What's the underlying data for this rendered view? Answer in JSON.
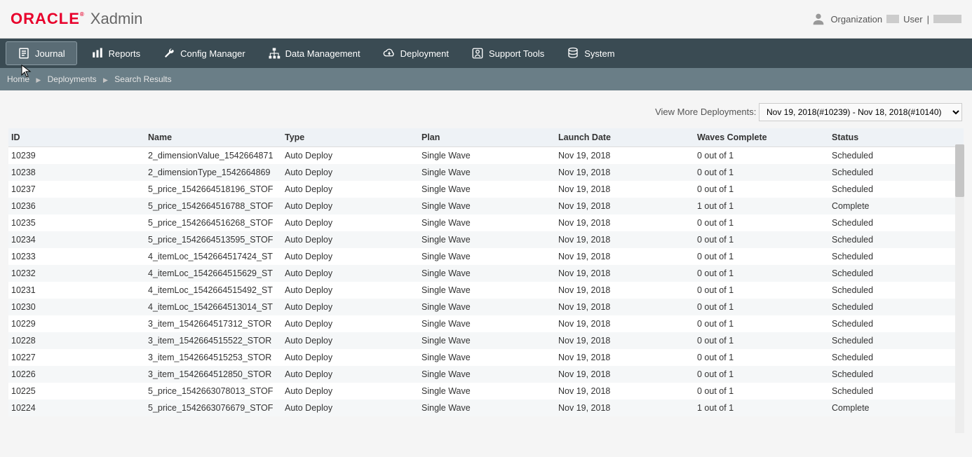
{
  "header": {
    "logo": "ORACLE",
    "app_name": "Xadmin",
    "org_label": "Organization",
    "user_label": "User",
    "user_sep": "|"
  },
  "nav": {
    "items": [
      {
        "label": "Journal"
      },
      {
        "label": "Reports"
      },
      {
        "label": "Config Manager"
      },
      {
        "label": "Data Management"
      },
      {
        "label": "Deployment"
      },
      {
        "label": "Support Tools"
      },
      {
        "label": "System"
      }
    ]
  },
  "breadcrumb": {
    "items": [
      "Home",
      "Deployments",
      "Search Results"
    ]
  },
  "view_more": {
    "label": "View More Deployments:",
    "selected": "Nov 19, 2018(#10239) - Nov 18, 2018(#10140)"
  },
  "table": {
    "headers": {
      "id": "ID",
      "name": "Name",
      "type": "Type",
      "plan": "Plan",
      "launch": "Launch Date",
      "waves": "Waves Complete",
      "status": "Status"
    },
    "rows": [
      {
        "id": "10239",
        "name": "2_dimensionValue_1542664871",
        "type": "Auto Deploy",
        "plan": "Single Wave",
        "launch": "Nov 19, 2018",
        "waves": "0 out of 1",
        "status": "Scheduled"
      },
      {
        "id": "10238",
        "name": "2_dimensionType_1542664869",
        "type": "Auto Deploy",
        "plan": "Single Wave",
        "launch": "Nov 19, 2018",
        "waves": "0 out of 1",
        "status": "Scheduled"
      },
      {
        "id": "10237",
        "name": "5_price_1542664518196_STOF",
        "type": "Auto Deploy",
        "plan": "Single Wave",
        "launch": "Nov 19, 2018",
        "waves": "0 out of 1",
        "status": "Scheduled"
      },
      {
        "id": "10236",
        "name": "5_price_1542664516788_STOF",
        "type": "Auto Deploy",
        "plan": "Single Wave",
        "launch": "Nov 19, 2018",
        "waves": "1 out of 1",
        "status": "Complete"
      },
      {
        "id": "10235",
        "name": "5_price_1542664516268_STOF",
        "type": "Auto Deploy",
        "plan": "Single Wave",
        "launch": "Nov 19, 2018",
        "waves": "0 out of 1",
        "status": "Scheduled"
      },
      {
        "id": "10234",
        "name": "5_price_1542664513595_STOF",
        "type": "Auto Deploy",
        "plan": "Single Wave",
        "launch": "Nov 19, 2018",
        "waves": "0 out of 1",
        "status": "Scheduled"
      },
      {
        "id": "10233",
        "name": "4_itemLoc_1542664517424_ST",
        "type": "Auto Deploy",
        "plan": "Single Wave",
        "launch": "Nov 19, 2018",
        "waves": "0 out of 1",
        "status": "Scheduled"
      },
      {
        "id": "10232",
        "name": "4_itemLoc_1542664515629_ST",
        "type": "Auto Deploy",
        "plan": "Single Wave",
        "launch": "Nov 19, 2018",
        "waves": "0 out of 1",
        "status": "Scheduled"
      },
      {
        "id": "10231",
        "name": "4_itemLoc_1542664515492_ST",
        "type": "Auto Deploy",
        "plan": "Single Wave",
        "launch": "Nov 19, 2018",
        "waves": "0 out of 1",
        "status": "Scheduled"
      },
      {
        "id": "10230",
        "name": "4_itemLoc_1542664513014_ST",
        "type": "Auto Deploy",
        "plan": "Single Wave",
        "launch": "Nov 19, 2018",
        "waves": "0 out of 1",
        "status": "Scheduled"
      },
      {
        "id": "10229",
        "name": "3_item_1542664517312_STOR",
        "type": "Auto Deploy",
        "plan": "Single Wave",
        "launch": "Nov 19, 2018",
        "waves": "0 out of 1",
        "status": "Scheduled"
      },
      {
        "id": "10228",
        "name": "3_item_1542664515522_STOR",
        "type": "Auto Deploy",
        "plan": "Single Wave",
        "launch": "Nov 19, 2018",
        "waves": "0 out of 1",
        "status": "Scheduled"
      },
      {
        "id": "10227",
        "name": "3_item_1542664515253_STOR",
        "type": "Auto Deploy",
        "plan": "Single Wave",
        "launch": "Nov 19, 2018",
        "waves": "0 out of 1",
        "status": "Scheduled"
      },
      {
        "id": "10226",
        "name": "3_item_1542664512850_STOR",
        "type": "Auto Deploy",
        "plan": "Single Wave",
        "launch": "Nov 19, 2018",
        "waves": "0 out of 1",
        "status": "Scheduled"
      },
      {
        "id": "10225",
        "name": "5_price_1542663078013_STOF",
        "type": "Auto Deploy",
        "plan": "Single Wave",
        "launch": "Nov 19, 2018",
        "waves": "0 out of 1",
        "status": "Scheduled"
      },
      {
        "id": "10224",
        "name": "5_price_1542663076679_STOF",
        "type": "Auto Deploy",
        "plan": "Single Wave",
        "launch": "Nov 19, 2018",
        "waves": "1 out of 1",
        "status": "Complete"
      }
    ]
  }
}
